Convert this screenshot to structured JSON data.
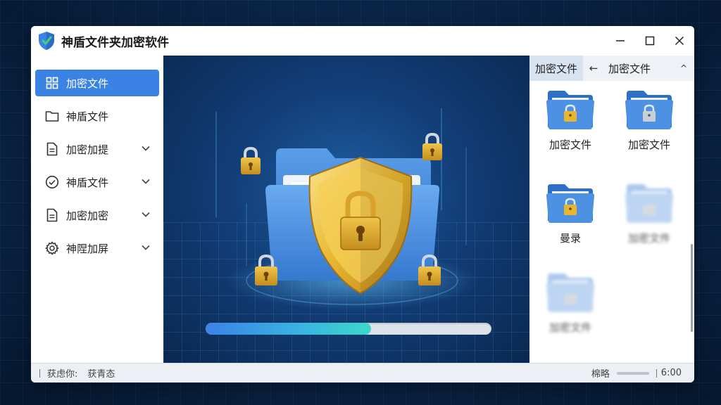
{
  "window": {
    "title": "神盾文件夹加密软件",
    "controls": {
      "minimize": "—",
      "maximize": "☐",
      "close": "✕"
    }
  },
  "sidebar": {
    "items": [
      {
        "label": "加密文件",
        "icon": "grid-icon",
        "active": true,
        "expandable": false
      },
      {
        "label": "神盾文件",
        "icon": "folder-icon",
        "active": false,
        "expandable": false
      },
      {
        "label": "加密加提",
        "icon": "document-icon",
        "active": false,
        "expandable": true
      },
      {
        "label": "神盾文件",
        "icon": "check-circle-icon",
        "active": false,
        "expandable": true
      },
      {
        "label": "加密加密",
        "icon": "document-icon",
        "active": false,
        "expandable": true
      },
      {
        "label": "神陧加屏",
        "icon": "gear-icon",
        "active": false,
        "expandable": true
      }
    ]
  },
  "stage": {
    "progress": 0.58,
    "icons": [
      "folder-icon",
      "shield-icon",
      "padlock-icon"
    ]
  },
  "right_pane": {
    "tabs": {
      "active": "加密文件",
      "back": "←",
      "other": "加密文件",
      "up": "^"
    },
    "files": [
      {
        "label": "加密文件",
        "locked": true,
        "blurred": false
      },
      {
        "label": "加密文件",
        "locked": true,
        "blurred": false
      },
      {
        "label": "曼录",
        "locked": true,
        "blurred": false
      },
      {
        "label": "加密文件",
        "locked": true,
        "blurred": true
      },
      {
        "label": "加密文件",
        "locked": true,
        "blurred": true
      }
    ]
  },
  "status_bar": {
    "left_label": "获虑你:",
    "left_value": "获青态",
    "right_label": "棉略",
    "right_value": "6:00"
  },
  "colors": {
    "accent": "#3a82e4",
    "shield_gold": "#e8b530",
    "folder_blue": "#3d86dc",
    "stage_bg": "#123e77"
  }
}
